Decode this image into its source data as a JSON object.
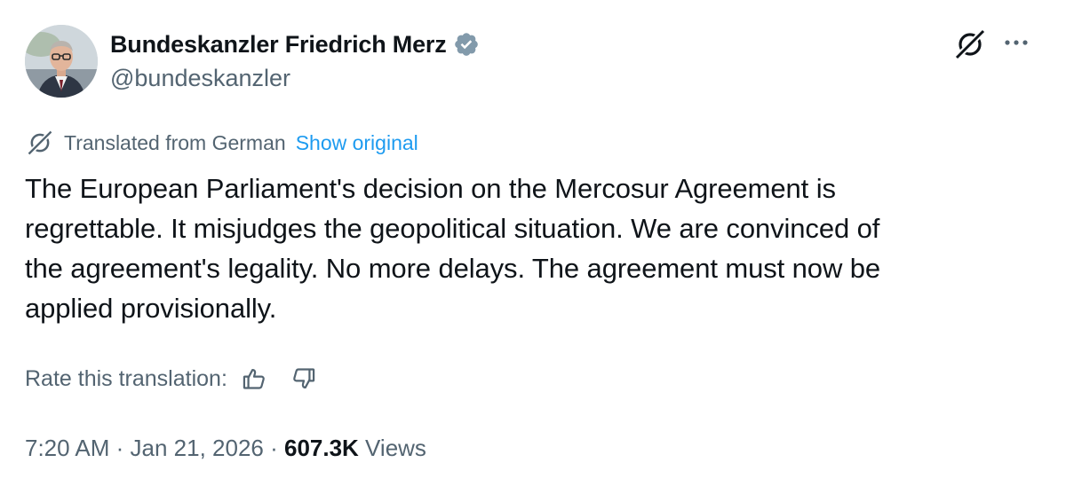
{
  "author": {
    "display_name": "Bundeskanzler Friedrich Merz",
    "handle": "@bundeskanzler",
    "verified": true
  },
  "translation": {
    "notice": "Translated from German",
    "show_original": "Show original"
  },
  "post": {
    "lines": [
      "The European Parliament's decision on the Mercosur Agreement is",
      "regrettable. It misjudges the geopolitical situation. We are convinced of",
      "the agreement's legality. No more delays. The agreement must now be",
      "applied provisionally."
    ]
  },
  "rating": {
    "label": "Rate this translation:"
  },
  "meta": {
    "time": "7:20 AM",
    "separator": " · ",
    "date": "Jan 21, 2026",
    "views_count": "607.3K",
    "views_label": " Views"
  },
  "icons": {
    "verified": "verified-badge-icon",
    "grok": "grok-icon",
    "more": "more-dots-icon",
    "translate": "translate-icon",
    "thumbs_up": "thumbs-up-icon",
    "thumbs_down": "thumbs-down-icon"
  },
  "colors": {
    "text": "#0f1419",
    "secondary": "#536471",
    "link": "#1d9bf0",
    "verified_badge": "#829aab"
  }
}
